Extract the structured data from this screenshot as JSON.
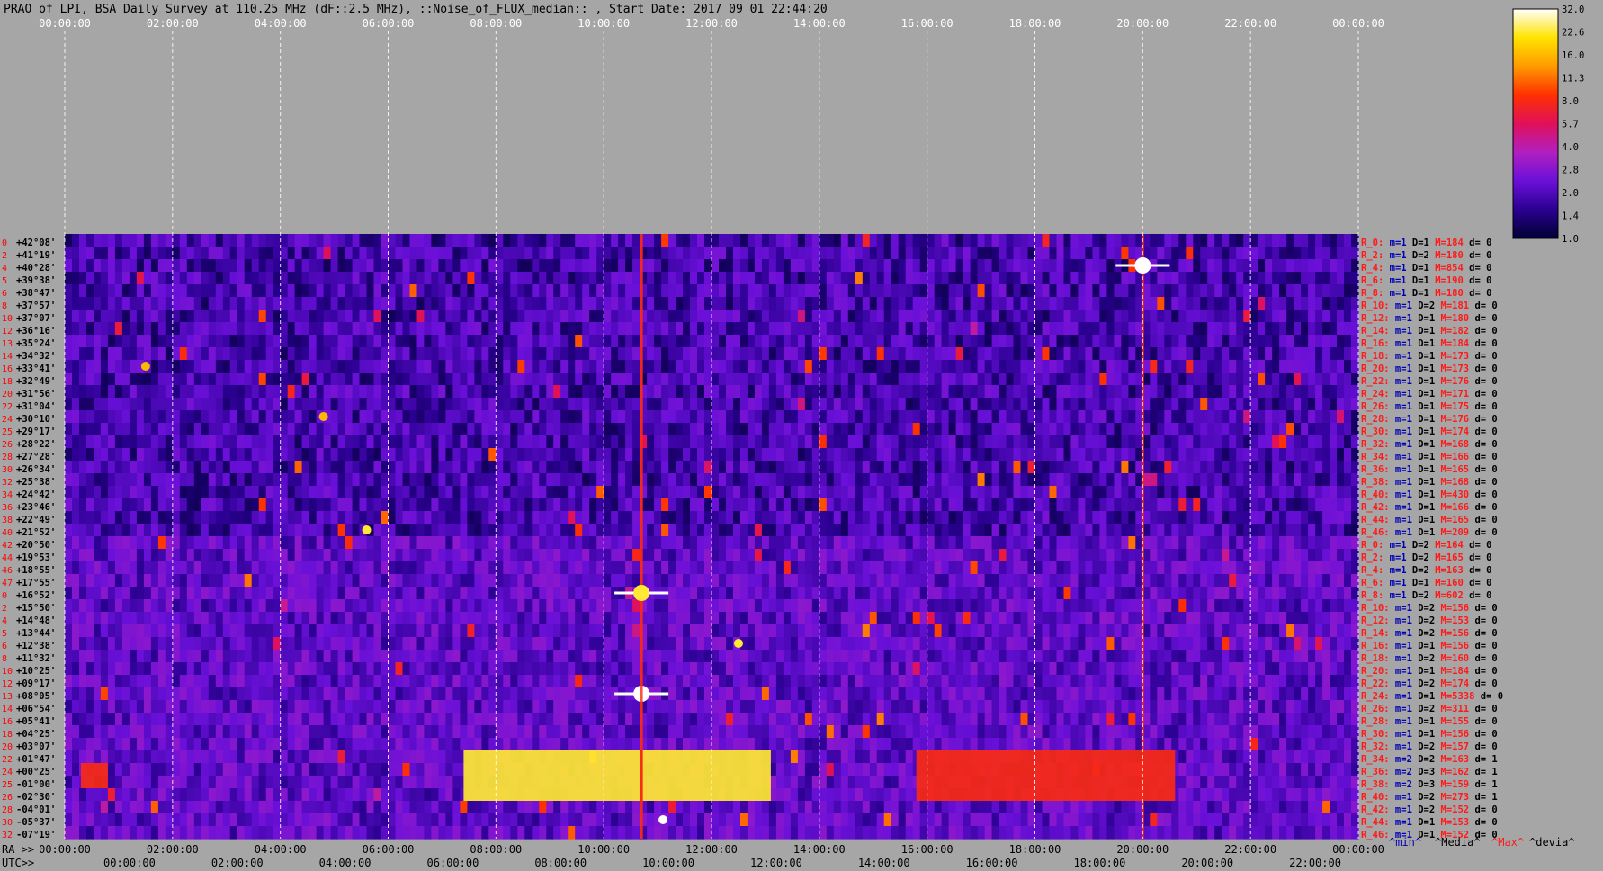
{
  "header": {
    "title": "PRAO of LPI, BSA Daily Survey at 110.25 MHz (dF::2.5 MHz), ::Noise_of_FLUX_median:: , Start Date: 2017 09 01 22:44:20"
  },
  "top_time_labels": [
    "00:00:00",
    "02:00:00",
    "04:00:00",
    "06:00:00",
    "08:00:00",
    "10:00:00",
    "12:00:00",
    "14:00:00",
    "16:00:00",
    "18:00:00",
    "20:00:00",
    "22:00:00",
    "00:00:00"
  ],
  "bottom_axis": {
    "ra_prefix": "RA >>",
    "utc_prefix": "UTC>>",
    "ra_labels": [
      "00:00:00",
      "02:00:00",
      "04:00:00",
      "06:00:00",
      "08:00:00",
      "10:00:00",
      "12:00:00",
      "14:00:00",
      "16:00:00",
      "18:00:00",
      "20:00:00",
      "22:00:00",
      "00:00:00"
    ],
    "utc_labels": [
      "00:00:00",
      "02:00:00",
      "04:00:00",
      "06:00:00",
      "08:00:00",
      "10:00:00",
      "12:00:00",
      "14:00:00",
      "16:00:00",
      "18:00:00",
      "20:00:00",
      "22:00:00"
    ]
  },
  "colorbar": {
    "ticks": [
      "32.0",
      "22.6",
      "16.0",
      "11.3",
      "8.0",
      "5.7",
      "4.0",
      "2.8",
      "2.0",
      "1.4",
      "1.0"
    ],
    "min": 1.0,
    "max": 32.0,
    "scale": "log2",
    "colors": [
      "#000033",
      "#2a0090",
      "#6a10d8",
      "#b020c0",
      "#e0105a",
      "#ff3000",
      "#ff9a00",
      "#ffe400",
      "#ffffff"
    ]
  },
  "legend": {
    "min": "^min^",
    "median": "^Media^",
    "max": "^Max^",
    "dev": "^devia^",
    "colors": {
      "min": "#0000b4",
      "median": "#000000",
      "max": "#ff1a1a",
      "dev": "#000000"
    }
  },
  "chart_data": {
    "type": "heatmap",
    "title": "PRAO of LPI, BSA Daily Survey at 110.25 MHz (dF::2.5 MHz), ::Noise_of_FLUX_median:: , Start Date: 2017 09 01 22:44:20",
    "xlabel": "RA",
    "x_range_hours": [
      0,
      24
    ],
    "color_range": [
      1.0,
      32.0
    ],
    "beam_numbers": [
      "0",
      "2",
      "4",
      "5",
      "6",
      "8",
      "10",
      "12",
      "13",
      "14",
      "16",
      "18",
      "20",
      "22",
      "24",
      "25",
      "26",
      "28",
      "30",
      "32",
      "34",
      "36",
      "38",
      "40",
      "42",
      "44",
      "46",
      "47",
      "0",
      "2",
      "4",
      "5",
      "6",
      "8",
      "10",
      "12",
      "13",
      "14",
      "16",
      "18",
      "20",
      "22",
      "24",
      "25",
      "26",
      "28",
      "30",
      "32",
      "34",
      "36",
      "38",
      "40",
      "42",
      "44",
      "46",
      "47"
    ],
    "declinations": [
      "+42°08'",
      "+41°19'",
      "+40°28'",
      "+39°38'",
      "+38°47'",
      "+37°57'",
      "+37°07'",
      "+36°16'",
      "+35°24'",
      "+34°32'",
      "+33°41'",
      "+32°49'",
      "+31°56'",
      "+31°04'",
      "+30°10'",
      "+29°17'",
      "+28°22'",
      "+27°28'",
      "+26°34'",
      "+25°38'",
      "+24°42'",
      "+23°46'",
      "+22°49'",
      "+21°52'",
      "+20°50'",
      "+19°53'",
      "+18°55'",
      "+17°55'",
      "+16°52'",
      "+15°50'",
      "+14°48'",
      "+13°44'",
      "+12°38'",
      "+11°32'",
      "+10°25'",
      "+09°17'",
      "+08°05'",
      "+06°54'",
      "+05°41'",
      "+04°25'",
      "+03°07'",
      "+01°47'",
      "+00°25'",
      "-01°00'",
      "-02°30'",
      "-04°01'",
      "-05°37'",
      "-07°19'"
    ],
    "beam_stats": [
      {
        "r": "R_0:",
        "m": "m=1",
        "d": "D=1",
        "mx": "M=184",
        "dv": "d= 0"
      },
      {
        "r": "R_2:",
        "m": "m=1",
        "d": "D=2",
        "mx": "M=180",
        "dv": "d= 0"
      },
      {
        "r": "R_4:",
        "m": "m=1",
        "d": "D=1",
        "mx": "M=854",
        "dv": "d= 0"
      },
      {
        "r": "R_6:",
        "m": "m=1",
        "d": "D=1",
        "mx": "M=190",
        "dv": "d= 0"
      },
      {
        "r": "R_8:",
        "m": "m=1",
        "d": "D=1",
        "mx": "M=180",
        "dv": "d= 0"
      },
      {
        "r": "R_10:",
        "m": "m=1",
        "d": "D=2",
        "mx": "M=181",
        "dv": "d= 0"
      },
      {
        "r": "R_12:",
        "m": "m=1",
        "d": "D=1",
        "mx": "M=180",
        "dv": "d= 0"
      },
      {
        "r": "R_14:",
        "m": "m=1",
        "d": "D=1",
        "mx": "M=182",
        "dv": "d= 0"
      },
      {
        "r": "R_16:",
        "m": "m=1",
        "d": "D=1",
        "mx": "M=184",
        "dv": "d= 0"
      },
      {
        "r": "R_18:",
        "m": "m=1",
        "d": "D=1",
        "mx": "M=173",
        "dv": "d= 0"
      },
      {
        "r": "R_20:",
        "m": "m=1",
        "d": "D=1",
        "mx": "M=173",
        "dv": "d= 0"
      },
      {
        "r": "R_22:",
        "m": "m=1",
        "d": "D=1",
        "mx": "M=176",
        "dv": "d= 0"
      },
      {
        "r": "R_24:",
        "m": "m=1",
        "d": "D=1",
        "mx": "M=171",
        "dv": "d= 0"
      },
      {
        "r": "R_26:",
        "m": "m=1",
        "d": "D=1",
        "mx": "M=175",
        "dv": "d= 0"
      },
      {
        "r": "R_28:",
        "m": "m=1",
        "d": "D=1",
        "mx": "M=176",
        "dv": "d= 0"
      },
      {
        "r": "R_30:",
        "m": "m=1",
        "d": "D=1",
        "mx": "M=174",
        "dv": "d= 0"
      },
      {
        "r": "R_32:",
        "m": "m=1",
        "d": "D=1",
        "mx": "M=168",
        "dv": "d= 0"
      },
      {
        "r": "R_34:",
        "m": "m=1",
        "d": "D=1",
        "mx": "M=166",
        "dv": "d= 0"
      },
      {
        "r": "R_36:",
        "m": "m=1",
        "d": "D=1",
        "mx": "M=165",
        "dv": "d= 0"
      },
      {
        "r": "R_38:",
        "m": "m=1",
        "d": "D=1",
        "mx": "M=168",
        "dv": "d= 0"
      },
      {
        "r": "R_40:",
        "m": "m=1",
        "d": "D=1",
        "mx": "M=430",
        "dv": "d= 0"
      },
      {
        "r": "R_42:",
        "m": "m=1",
        "d": "D=1",
        "mx": "M=166",
        "dv": "d= 0"
      },
      {
        "r": "R_44:",
        "m": "m=1",
        "d": "D=1",
        "mx": "M=165",
        "dv": "d= 0"
      },
      {
        "r": "R_46:",
        "m": "m=1",
        "d": "D=1",
        "mx": "M=209",
        "dv": "d= 0"
      },
      {
        "r": "R_0:",
        "m": "m=1",
        "d": "D=2",
        "mx": "M=164",
        "dv": "d= 0"
      },
      {
        "r": "R_2:",
        "m": "m=1",
        "d": "D=2",
        "mx": "M=165",
        "dv": "d= 0"
      },
      {
        "r": "R_4:",
        "m": "m=1",
        "d": "D=2",
        "mx": "M=163",
        "dv": "d= 0"
      },
      {
        "r": "R_6:",
        "m": "m=1",
        "d": "D=1",
        "mx": "M=160",
        "dv": "d= 0"
      },
      {
        "r": "R_8:",
        "m": "m=1",
        "d": "D=2",
        "mx": "M=602",
        "dv": "d= 0"
      },
      {
        "r": "R_10:",
        "m": "m=1",
        "d": "D=2",
        "mx": "M=156",
        "dv": "d= 0"
      },
      {
        "r": "R_12:",
        "m": "m=1",
        "d": "D=2",
        "mx": "M=153",
        "dv": "d= 0"
      },
      {
        "r": "R_14:",
        "m": "m=1",
        "d": "D=2",
        "mx": "M=156",
        "dv": "d= 0"
      },
      {
        "r": "R_16:",
        "m": "m=1",
        "d": "D=1",
        "mx": "M=156",
        "dv": "d= 0"
      },
      {
        "r": "R_18:",
        "m": "m=1",
        "d": "D=2",
        "mx": "M=160",
        "dv": "d= 0"
      },
      {
        "r": "R_20:",
        "m": "m=1",
        "d": "D=1",
        "mx": "M=184",
        "dv": "d= 0"
      },
      {
        "r": "R_22:",
        "m": "m=1",
        "d": "D=2",
        "mx": "M=174",
        "dv": "d= 0"
      },
      {
        "r": "R_24:",
        "m": "m=1",
        "d": "D=1",
        "mx": "M=5338",
        "dv": "d= 0"
      },
      {
        "r": "R_26:",
        "m": "m=1",
        "d": "D=2",
        "mx": "M=311",
        "dv": "d= 0"
      },
      {
        "r": "R_28:",
        "m": "m=1",
        "d": "D=1",
        "mx": "M=155",
        "dv": "d= 0"
      },
      {
        "r": "R_30:",
        "m": "m=1",
        "d": "D=1",
        "mx": "M=156",
        "dv": "d= 0"
      },
      {
        "r": "R_32:",
        "m": "m=1",
        "d": "D=2",
        "mx": "M=157",
        "dv": "d= 0"
      },
      {
        "r": "R_34:",
        "m": "m=2",
        "d": "D=2",
        "mx": "M=163",
        "dv": "d= 1"
      },
      {
        "r": "R_36:",
        "m": "m=2",
        "d": "D=3",
        "mx": "M=162",
        "dv": "d= 1"
      },
      {
        "r": "R_38:",
        "m": "m=2",
        "d": "D=3",
        "mx": "M=159",
        "dv": "d= 1"
      },
      {
        "r": "R_40:",
        "m": "m=1",
        "d": "D=2",
        "mx": "M=273",
        "dv": "d= 1"
      },
      {
        "r": "R_42:",
        "m": "m=1",
        "d": "D=2",
        "mx": "M=152",
        "dv": "d= 0"
      },
      {
        "r": "R_44:",
        "m": "m=1",
        "d": "D=1",
        "mx": "M=153",
        "dv": "d= 0"
      },
      {
        "r": "R_46:",
        "m": "m=1",
        "d": "D=1",
        "mx": "M=152",
        "dv": "d= 0"
      }
    ],
    "bright_sources": [
      {
        "ra_h": 10.7,
        "dec_row": 36,
        "value": 32.0,
        "kind": "star"
      },
      {
        "ra_h": 10.7,
        "dec_row": 28,
        "value": 22.6,
        "kind": "star"
      },
      {
        "ra_h": 20.0,
        "dec_row": 2,
        "value": 32.0,
        "kind": "star"
      },
      {
        "ra_h": 11.1,
        "dec_row": 46,
        "value": 32.0,
        "kind": "blob"
      },
      {
        "ra_h": 12.5,
        "dec_row": 32,
        "value": 22.6,
        "kind": "blob"
      },
      {
        "ra_h": 5.6,
        "dec_row": 23,
        "value": 22.6,
        "kind": "blob"
      },
      {
        "ra_h": 4.8,
        "dec_row": 14,
        "value": 16.0,
        "kind": "blob"
      },
      {
        "ra_h": 1.5,
        "dec_row": 10,
        "value": 16.0,
        "kind": "blob"
      }
    ],
    "interference_bands": [
      {
        "ra_start_h": 7.4,
        "ra_end_h": 13.1,
        "row_start": 41,
        "row_end": 45,
        "value": 22.6
      },
      {
        "ra_start_h": 15.8,
        "ra_end_h": 20.6,
        "row_start": 41,
        "row_end": 45,
        "value": 8.0
      },
      {
        "ra_start_h": 0.3,
        "ra_end_h": 0.8,
        "row_start": 42,
        "row_end": 44,
        "value": 8.0
      }
    ]
  }
}
